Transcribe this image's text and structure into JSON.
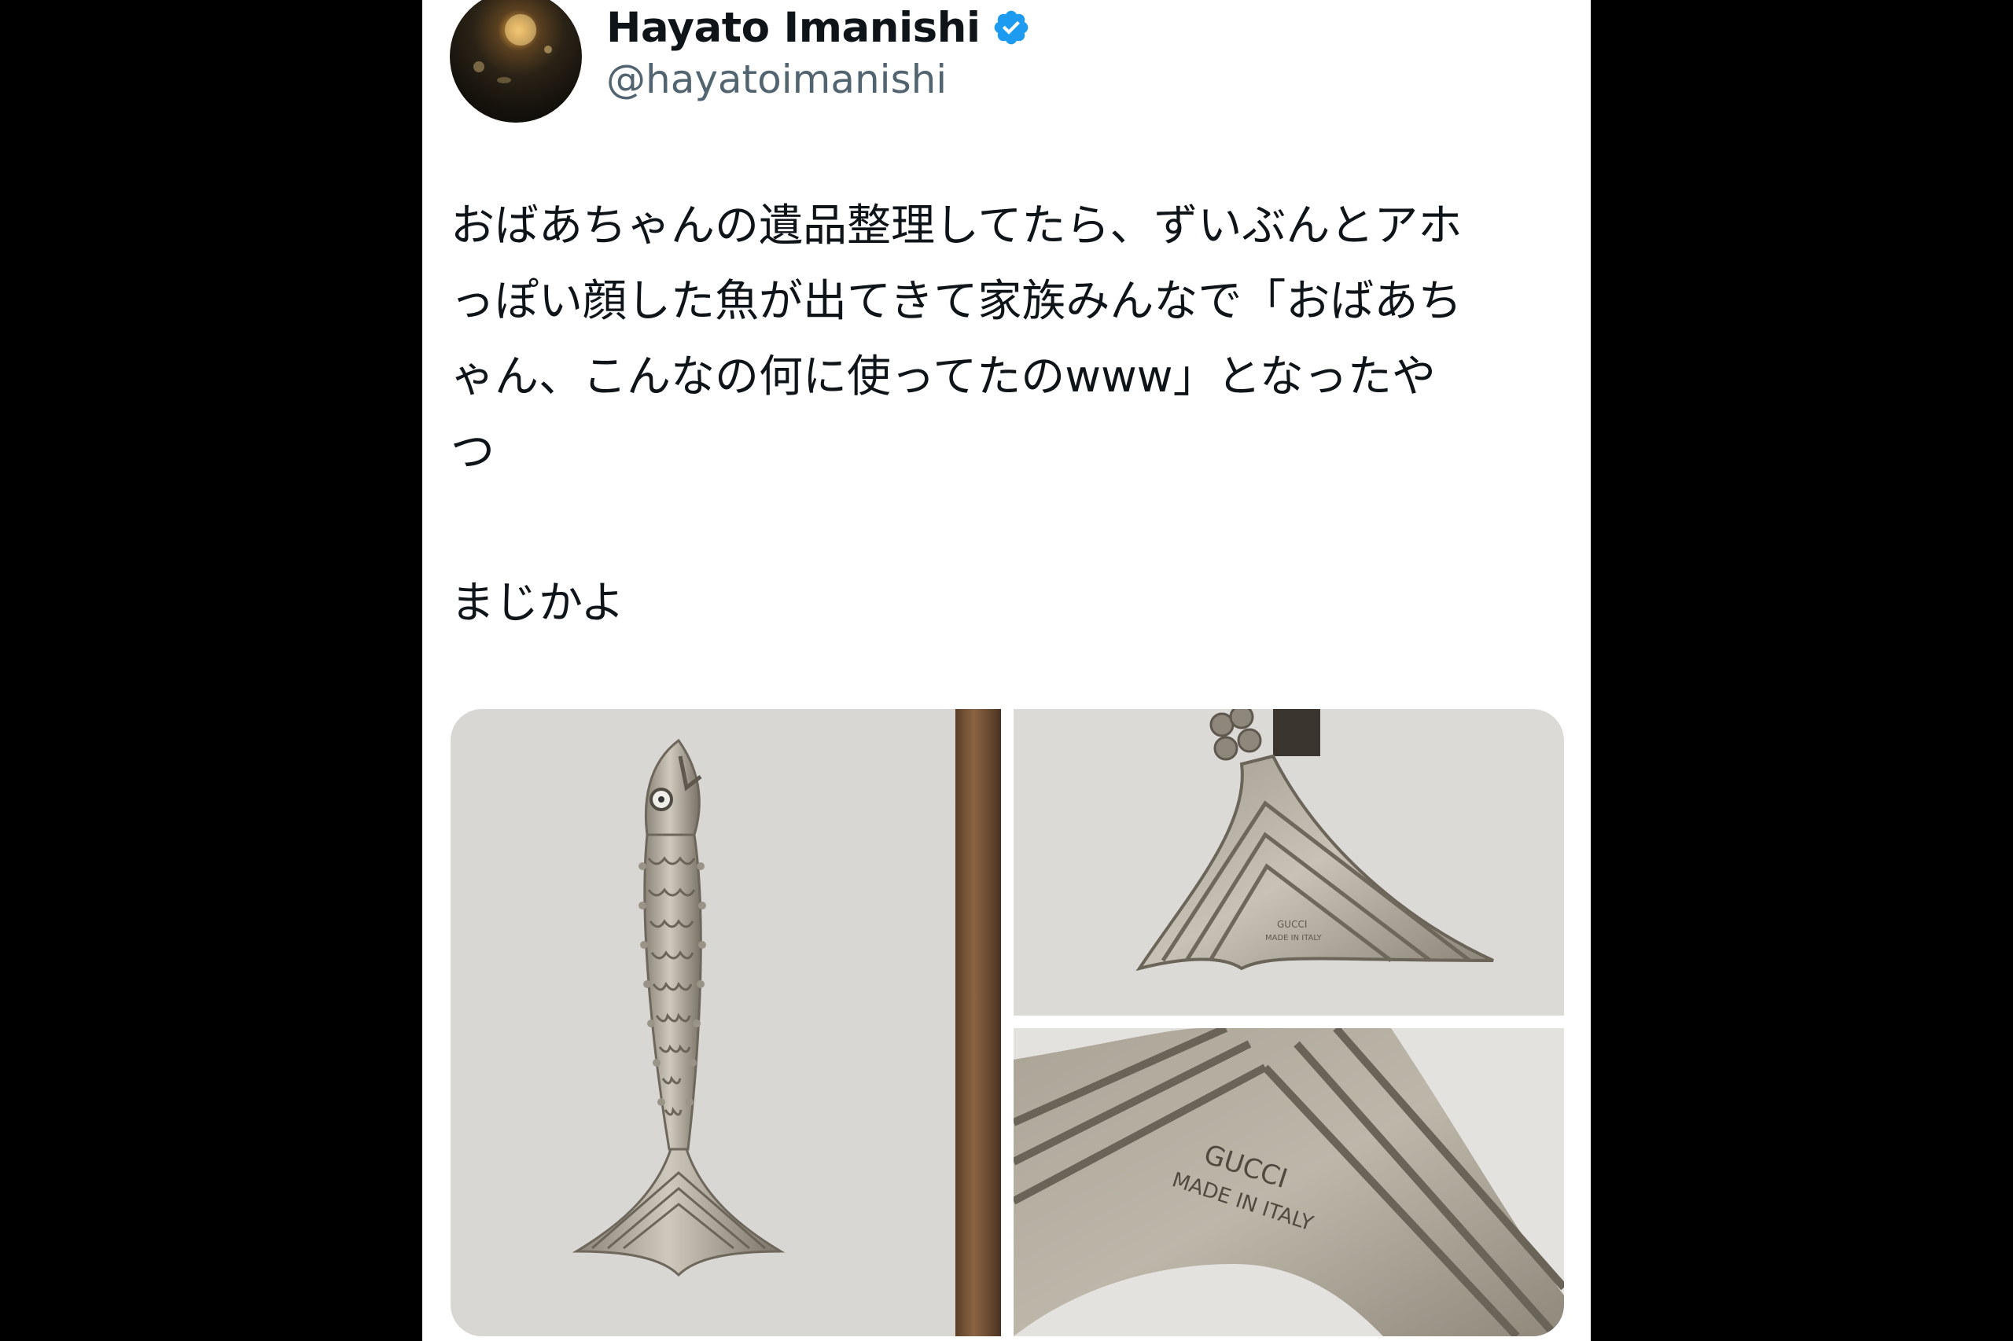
{
  "user": {
    "display_name": "Hayato Imanishi",
    "handle": "@hayatoimanishi",
    "verified_badge_icon": "verified-check-icon",
    "avatar_icon": "avatar-photo"
  },
  "tweet": {
    "paragraph1_lines": [
      "おばあちゃんの遺品整理してたら、ずいぶんとアホ",
      "っぽい顔した魚が出てきて家族みんなで「おばあち",
      "ゃん、こんなの何に使ってたのwww」となったや",
      "つ"
    ],
    "paragraph2": "まじかよ"
  },
  "media": {
    "images": [
      {
        "subject": "silver fish bottle opener, full view"
      },
      {
        "subject": "fish tail close-up"
      },
      {
        "subject": "tail engraving close-up"
      }
    ],
    "engraving_line1": "GUCCI",
    "engraving_line2": "MADE IN ITALY"
  },
  "colors": {
    "background": "#000000",
    "card": "#ffffff",
    "text_primary": "#0f1419",
    "text_secondary": "#536471",
    "verified_blue": "#1d9bf0"
  }
}
